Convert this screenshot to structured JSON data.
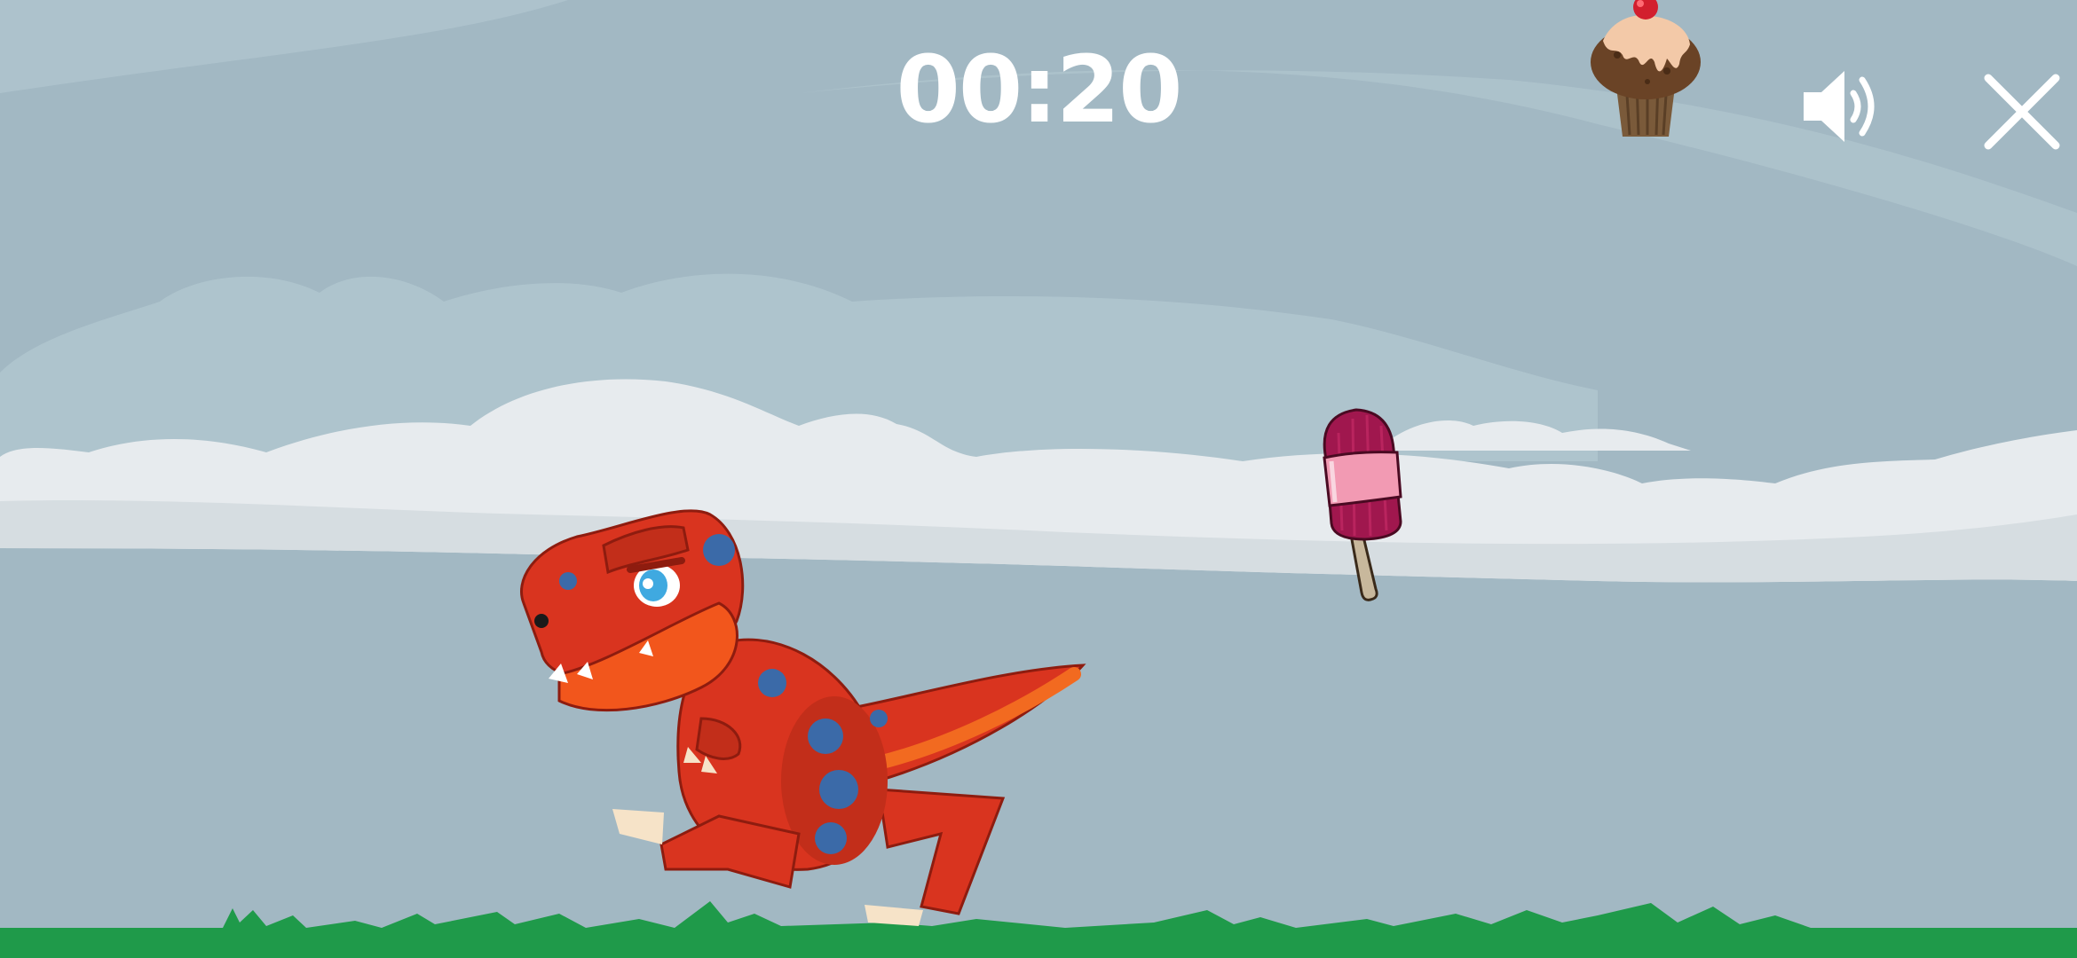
{
  "hud": {
    "timer": "00:20",
    "sound_icon": "speaker-volume-icon",
    "close_icon": "close-x-icon"
  },
  "scene": {
    "sky_color": "#a2b8c3",
    "ground_color": "#1f9a4a",
    "player": "red-t-rex-dinosaur",
    "items": [
      "cupcake",
      "popsicle"
    ]
  }
}
